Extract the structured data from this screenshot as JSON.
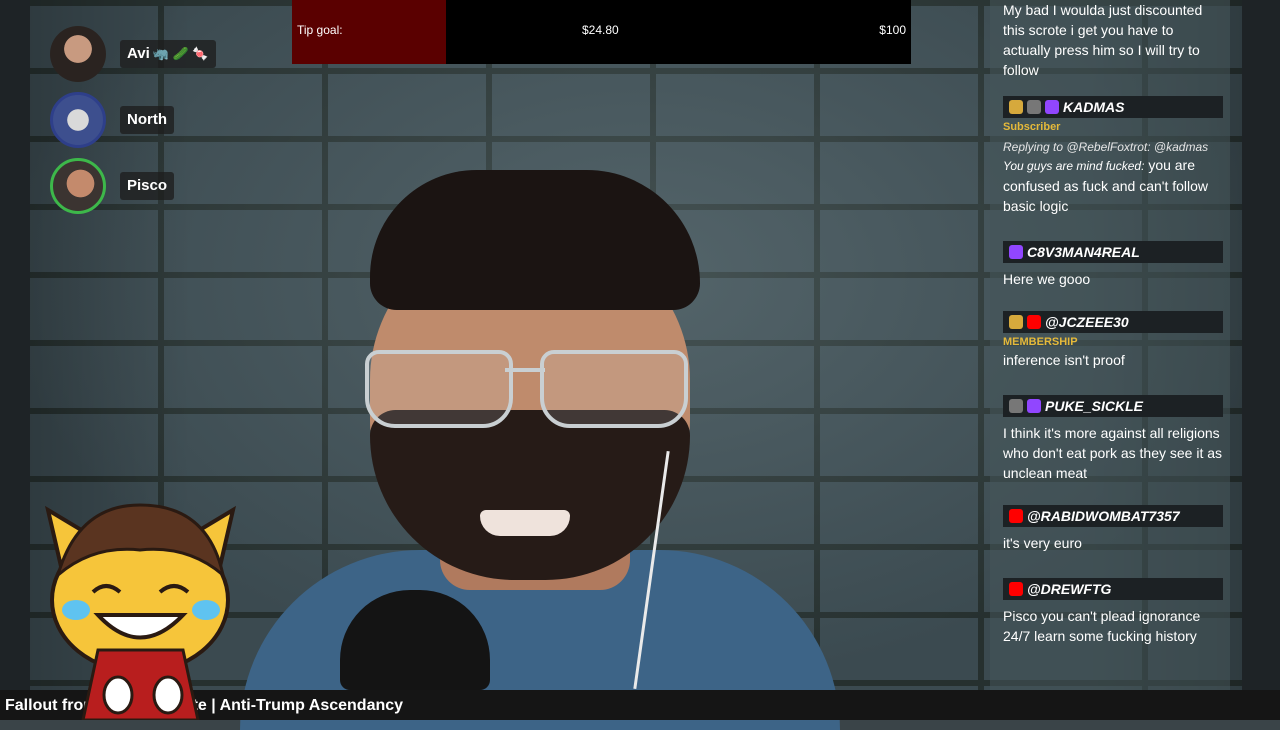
{
  "tip_goal": {
    "label": "Tip goal:",
    "current": "$24.80",
    "target": "$100",
    "progress_fraction": 0.248
  },
  "speakers": [
    {
      "name": "Avi",
      "emoji": "🦏 🥒 🍬"
    },
    {
      "name": "North",
      "emoji": ""
    },
    {
      "name": "Pisco",
      "emoji": ""
    }
  ],
  "chat": {
    "messages": [
      {
        "author": "",
        "role": "",
        "reply": "",
        "prefix": "",
        "text": "My bad I woulda just discounted this scrote i get you have to actually press him so I will try to follow",
        "badges": []
      },
      {
        "author": "KADMAS",
        "role": "Subscriber",
        "reply": "Replying to @RebelFoxtrot: @kadmas",
        "prefix": "You guys are mind fucked:",
        "text": "you are confused as fuck and can't follow basic logic",
        "badges": [
          "sub-badge",
          "gift-badge",
          "twitch-icon"
        ]
      },
      {
        "author": "C8V3MAN4REAL",
        "role": "",
        "reply": "",
        "prefix": "",
        "text": "Here we gooo",
        "badges": [
          "twitch-icon"
        ]
      },
      {
        "author": "@JCZEEE30",
        "role": "MEMBERSHIP",
        "reply": "",
        "prefix": "",
        "text": "inference isn't proof",
        "badges": [
          "member-badge",
          "youtube-icon"
        ]
      },
      {
        "author": "PUKE_SICKLE",
        "role": "",
        "reply": "",
        "prefix": "",
        "text": "I think it's more against all religions who don't eat pork as they see it as unclean meat",
        "badges": [
          "misc-badge",
          "twitch-icon"
        ]
      },
      {
        "author": "@RABIDWOMBAT7357",
        "role": "",
        "reply": "",
        "prefix": "",
        "text": "it's very euro",
        "badges": [
          "youtube-icon"
        ]
      },
      {
        "author": "@DREWFTG",
        "role": "",
        "reply": "",
        "prefix": "",
        "text": "Pisco you can't plead ignorance 24/7 learn some fucking history",
        "badges": [
          "youtube-icon"
        ]
      }
    ]
  },
  "video": {
    "title": "Fallout from Space Debate | Anti-Trump Ascendancy"
  },
  "colors": {
    "tip_fill": "#5a0000",
    "twitch": "#9146ff",
    "youtube": "#ff0000",
    "subscriber": "#e5b93a"
  }
}
